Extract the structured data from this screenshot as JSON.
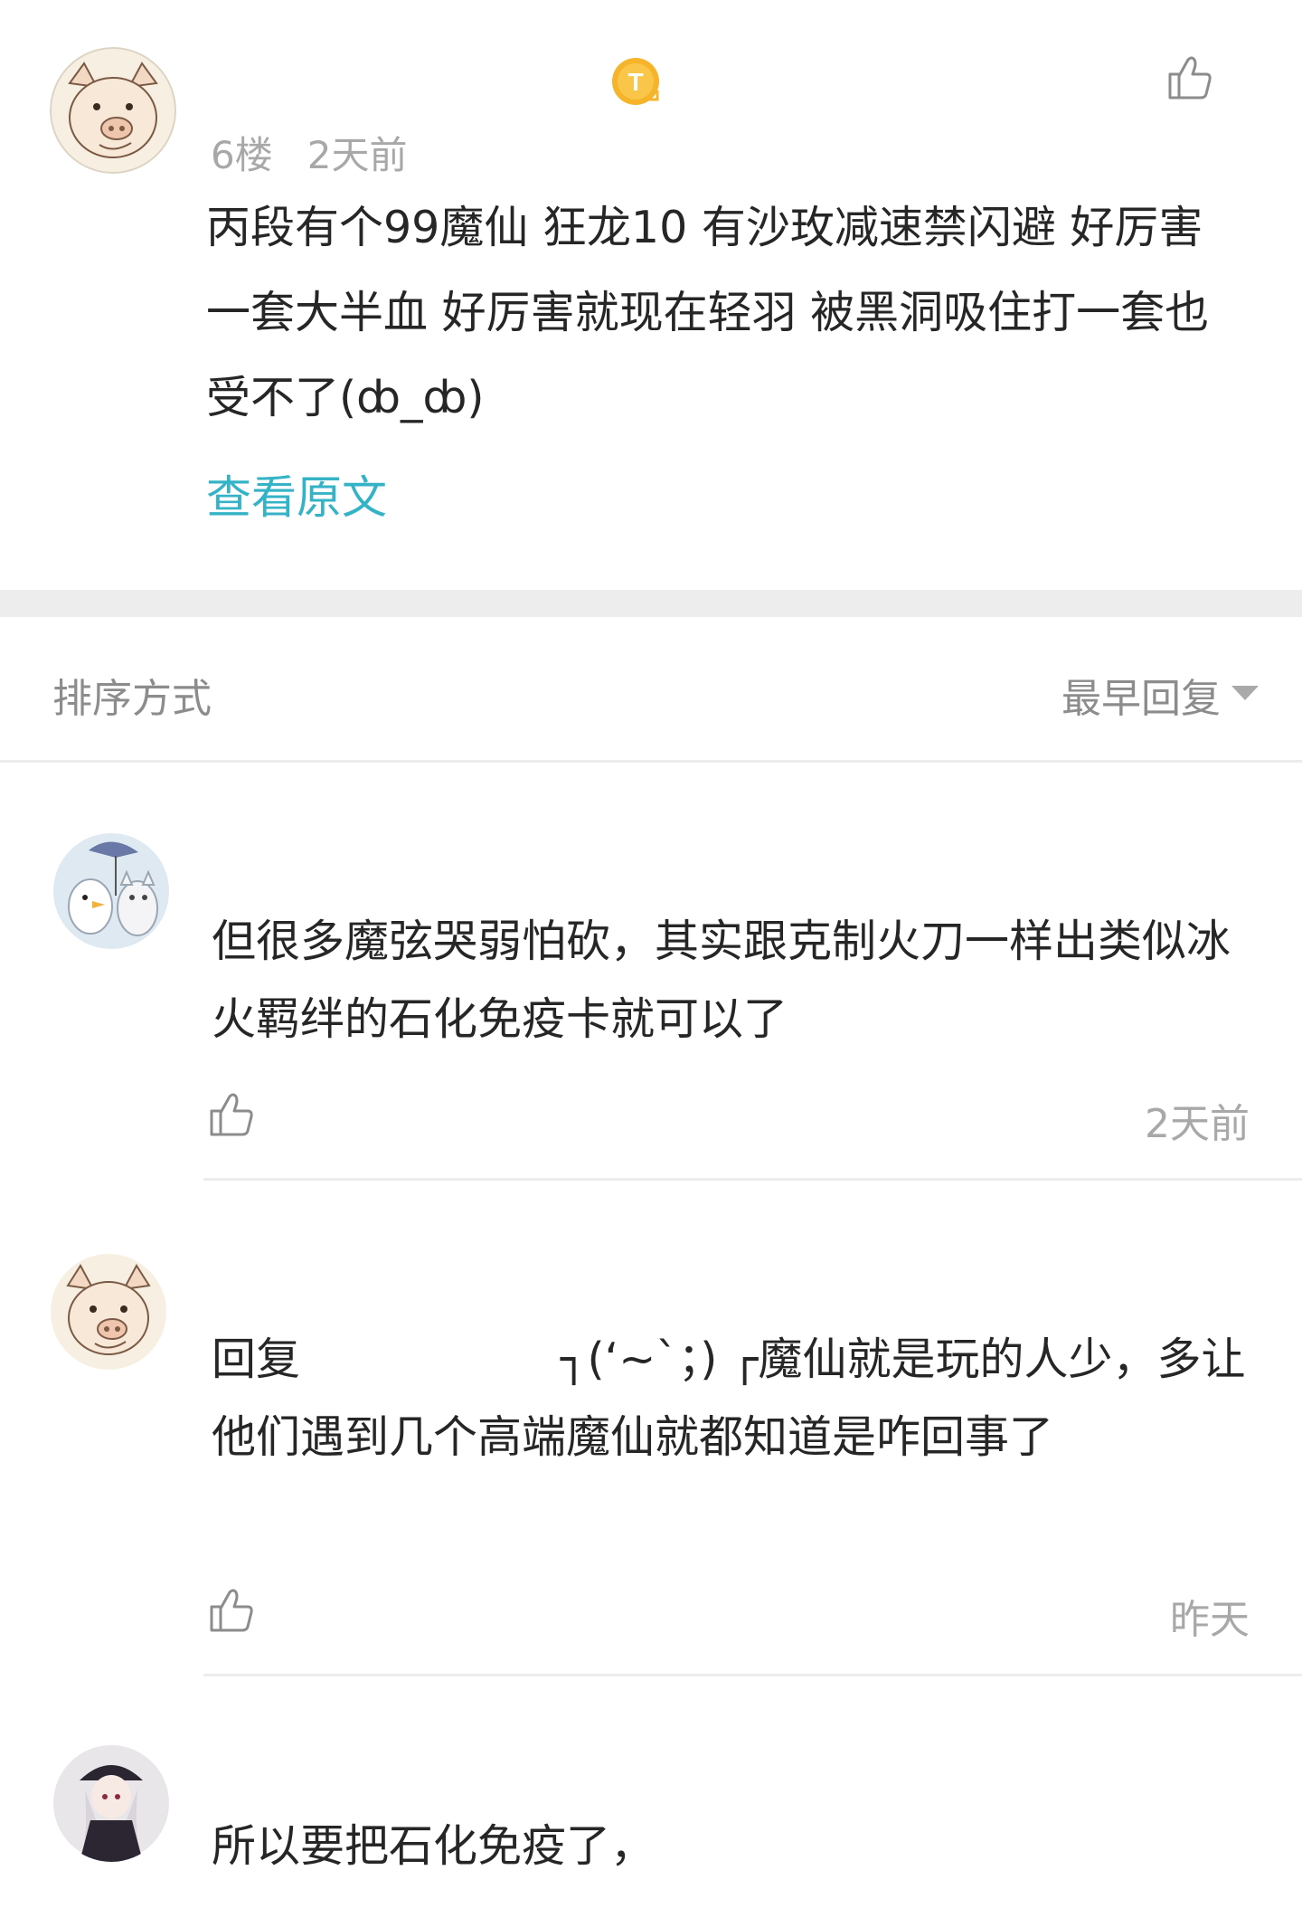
{
  "post": {
    "floor": "6楼",
    "time": "2天前",
    "body": "丙段有个99魔仙 狂龙10 有沙玫减速禁闪避 好厉害一套大半血 好厉害就现在轻羽 被黑洞吸住打一套也受不了(ȸ_ȸ)",
    "view_original": "查看原文",
    "coin_letter": "T"
  },
  "sort": {
    "label": "排序方式",
    "value": "最早回复"
  },
  "replies": [
    {
      "text": "但很多魔弦哭弱怕砍，其实跟克制火刀一样出类似冰火羁绊的石化免疫卡就可以了",
      "time": "2天前"
    },
    {
      "prefix": "回复",
      "text_tail": "┐(‘~`；) ┌魔仙就是玩的人少，多让他们遇到几个高端魔仙就都知道是咋回事了",
      "time": "昨天"
    },
    {
      "text": "所以要把石化免疫了，"
    }
  ],
  "colors": {
    "link": "#34b3c6",
    "meta": "#a8a8a8",
    "divider": "#ececec",
    "section_gap": "#ededed"
  }
}
